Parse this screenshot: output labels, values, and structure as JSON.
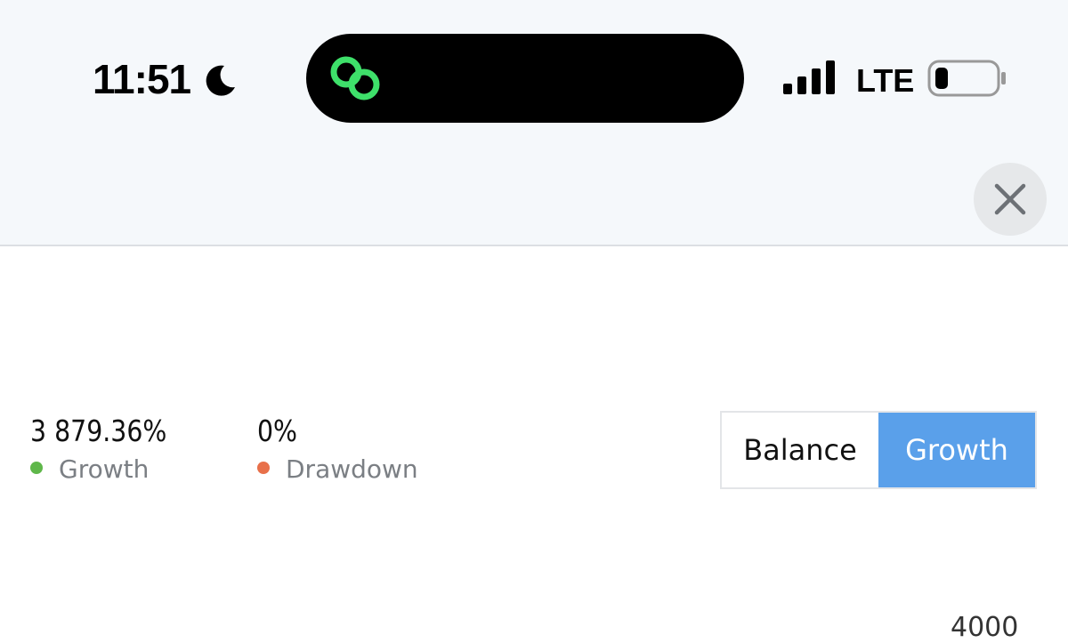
{
  "status_bar": {
    "time": "11:51",
    "moon_icon": "moon-icon",
    "island_icon": "link-rings-icon",
    "island_icon_color": "#3ee06a",
    "signal_icon": "cellular-signal-icon",
    "network": "LTE",
    "battery_icon": "battery-low-icon"
  },
  "header": {
    "close_icon": "close-icon"
  },
  "stats": {
    "growth": {
      "value": "3 879.36%",
      "label": "Growth",
      "color": "#5fb74a"
    },
    "drawdown": {
      "value": "0%",
      "label": "Drawdown",
      "color": "#e8704a"
    }
  },
  "toggle": {
    "options": [
      "Balance",
      "Growth"
    ],
    "selected": "Growth",
    "active_color": "#5aa0ea"
  },
  "chart": {
    "partial_axis_label": "4000"
  }
}
